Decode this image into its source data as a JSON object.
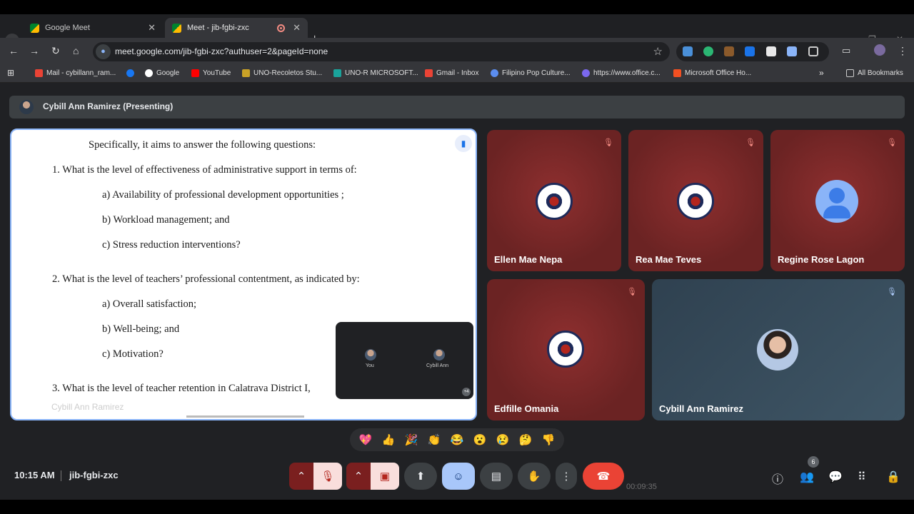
{
  "browser": {
    "tabs": [
      {
        "title": "Google Meet",
        "active": false
      },
      {
        "title": "Meet - jib-fgbi-zxc",
        "active": true
      }
    ],
    "new_tab": "+",
    "url": "meet.google.com/jib-fgbi-zxc?authuser=2&pageId=none",
    "bookmarks": [
      {
        "label": "Mail - cybillann_ram...",
        "color": "#ea4335"
      },
      {
        "label": "Google",
        "color": "#4285f4"
      },
      {
        "label": "YouTube",
        "color": "#ff0000"
      },
      {
        "label": "UNO-Recoletos Stu...",
        "color": "#c9a227"
      },
      {
        "label": "UNO-R MICROSOFT...",
        "color": "#1aa39b"
      },
      {
        "label": "Gmail - Inbox",
        "color": "#ea4335"
      },
      {
        "label": "Filipino Pop Culture...",
        "color": "#5b8def"
      },
      {
        "label": "https://www.office.c...",
        "color": "#7b68ee"
      },
      {
        "label": "Microsoft Office Ho...",
        "color": "#f25022"
      }
    ],
    "all_bookmarks": "All Bookmarks"
  },
  "meet": {
    "presenting": "Cybill Ann Ramirez (Presenting)",
    "slide": {
      "lines": [
        "Specifically, it aims to answer the following questions:",
        "1. What is the level of effectiveness of administrative support in terms of:",
        "a)   Availability of professional development opportunities ;",
        "b)   Workload management; and",
        "c)   Stress reduction interventions?",
        "2. What is the level of teachers’ professional contentment, as indicated by:",
        "a)   Overall satisfaction;",
        "b)   Well-being; and",
        "c)   Motivation?",
        "3. What is the level of teacher retention in Calatrava District I,"
      ],
      "overlay_name": "Cybill Ann Ramirez",
      "pip_you": "You",
      "pip_other": "Cybill Ann",
      "pip_more": "+4"
    },
    "participants": [
      {
        "name": "Ellen Mae Nepa"
      },
      {
        "name": "Rea Mae Teves"
      },
      {
        "name": "Regine Rose Lagon"
      },
      {
        "name": "Edfille Omania"
      },
      {
        "name": "Cybill Ann Ramirez"
      }
    ],
    "reactions": [
      "💖",
      "👍",
      "🎉",
      "👏",
      "😂",
      "😮",
      "😢",
      "🤔",
      "👎"
    ],
    "time": "10:15 AM",
    "meeting_code": "jib-fgbi-zxc",
    "people_count": "6",
    "ghost_timer": "00:09:35"
  }
}
